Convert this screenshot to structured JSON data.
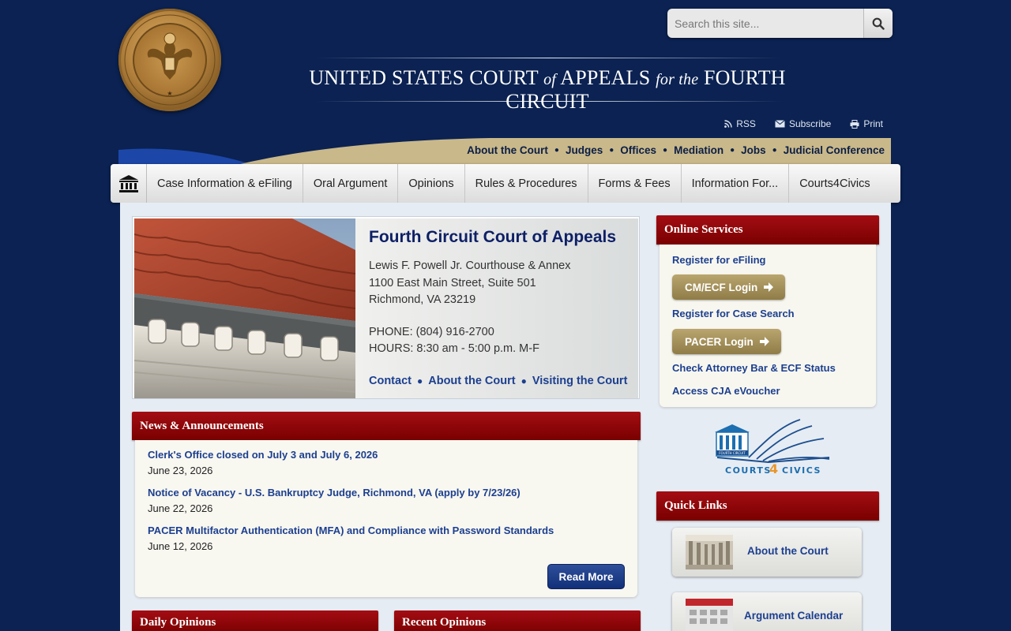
{
  "search": {
    "placeholder": "Search this site..."
  },
  "title": {
    "part1": "UNITED STATES COURT",
    "of": "of",
    "part2": "APPEALS",
    "for_the": "for the",
    "part3": "FOURTH CIRCUIT"
  },
  "utility": {
    "rss": "RSS",
    "subscribe": "Subscribe",
    "print": "Print"
  },
  "secondary_nav": [
    "About the Court",
    "Judges",
    "Offices",
    "Mediation",
    "Jobs",
    "Judicial Conference"
  ],
  "main_nav": [
    "Case Information & eFiling",
    "Oral Argument",
    "Opinions",
    "Rules & Procedures",
    "Forms & Fees",
    "Information For...",
    "Courts4Civics"
  ],
  "hero": {
    "title": "Fourth Circuit Court of Appeals",
    "address1": "Lewis F. Powell Jr. Courthouse & Annex",
    "address2": "1100 East Main Street, Suite 501",
    "address3": "Richmond, VA 23219",
    "phone": "PHONE: (804) 916-2700",
    "hours": "HOURS: 8:30 am - 5:00 p.m. M-F",
    "links": [
      "Contact",
      "About the Court",
      "Visiting the Court"
    ]
  },
  "news": {
    "heading": "News & Announcements",
    "items": [
      {
        "title": "Clerk's Office closed on July 3 and July 6, 2026",
        "date": "June 23, 2026"
      },
      {
        "title": "Notice of Vacancy - U.S. Bankruptcy Judge, Richmond, VA (apply by 7/23/26)",
        "date": "June 22, 2026"
      },
      {
        "title": "PACER Multifactor Authentication (MFA) and Compliance with Password Standards",
        "date": "June 12, 2026"
      }
    ],
    "read_more": "Read More"
  },
  "daily_opinions": {
    "heading": "Daily Opinions"
  },
  "recent_opinions": {
    "heading": "Recent Opinions"
  },
  "online_services": {
    "heading": "Online Services",
    "register_efiling": "Register for eFiling",
    "cmecf_login": "CM/ECF Login",
    "register_case_search": "Register for Case Search",
    "pacer_login": "PACER Login",
    "check_attorney": "Check Attorney Bar & ECF Status",
    "cja": "Access CJA eVoucher"
  },
  "courts4civics": {
    "line1": "COURTS",
    "four": "4",
    "line2": "CIVICS",
    "small": "FOURTH CIRCUIT"
  },
  "quick_links": {
    "heading": "Quick Links",
    "items": [
      "About the Court",
      "Argument Calendar"
    ]
  },
  "colors": {
    "navy": "#0b2252",
    "maroon": "#8b0000",
    "gold": "#c9b88a",
    "link": "#1c3f8f"
  }
}
